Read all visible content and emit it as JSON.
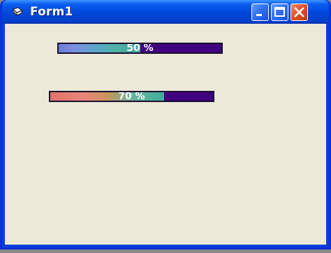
{
  "window": {
    "title": "Form1",
    "controls": {
      "minimize_icon": "minimize-icon",
      "maximize_icon": "maximize-icon",
      "close_icon": "close-icon"
    }
  },
  "progress_bars": [
    {
      "label": "50 %",
      "value": 0.5,
      "fill_color": "#6d7fd8",
      "track_color": "#40007f"
    },
    {
      "label": "70 %",
      "value": 0.7,
      "fill_color": "#e2736a",
      "track_color": "#40007f"
    }
  ]
}
